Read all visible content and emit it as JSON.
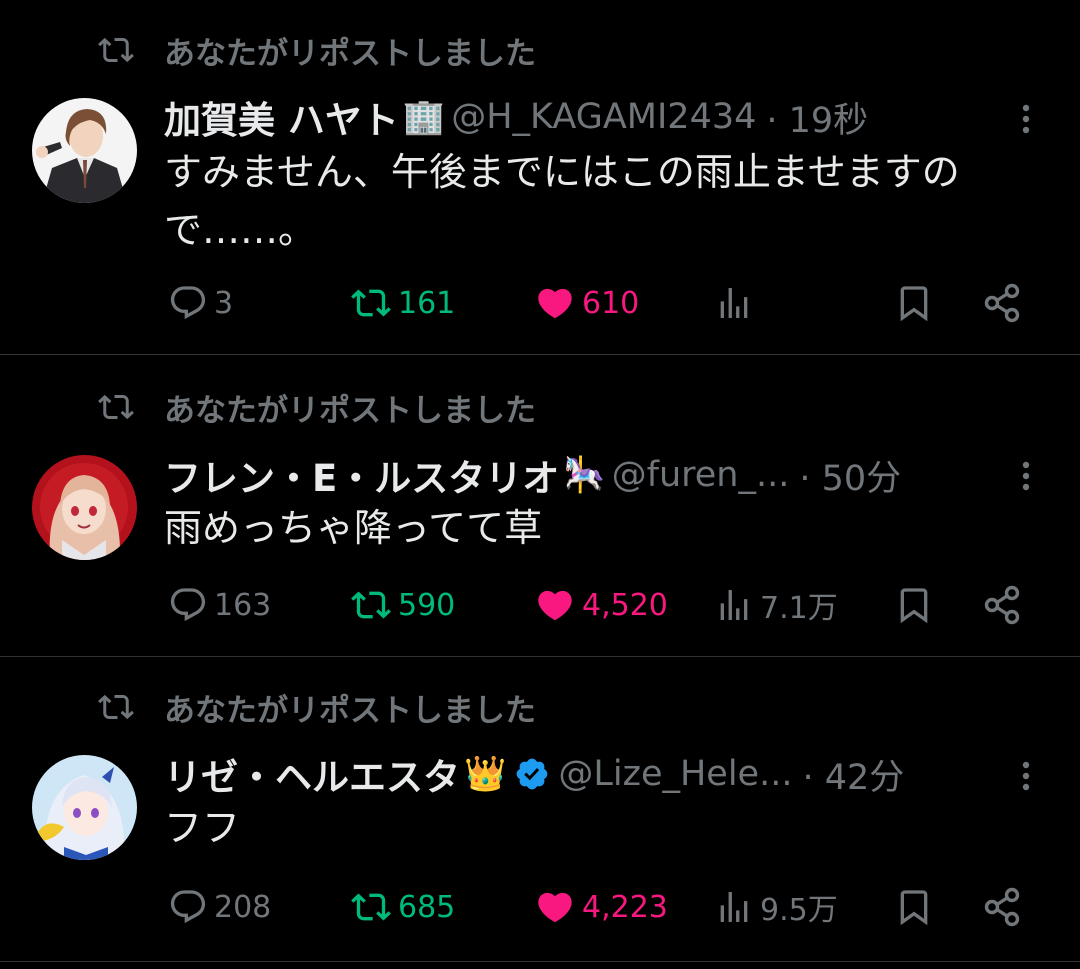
{
  "colors": {
    "background": "#000000",
    "primary_text": "#e7e9ea",
    "secondary_text": "#71767b",
    "retweet_green": "#00ba7c",
    "like_pink": "#f91880",
    "verified_blue": "#1d9bf0",
    "divider": "#2f3336"
  },
  "tweets": [
    {
      "repost_label": "あなたがリポストしました",
      "display_name": "加賀美 ハヤト",
      "name_emoji": "🏢",
      "handle": "@H_KAGAMI2434",
      "time": "· 19秒",
      "text": "すみません、午後までにはこの雨止ませますので……。",
      "replies": "3",
      "reposts": "161",
      "likes": "610",
      "views": "",
      "liked": true,
      "reposted": true,
      "verified": false
    },
    {
      "repost_label": "あなたがリポストしました",
      "display_name": "フレン・E・ルスタリオ",
      "name_emoji": "🎠",
      "handle": "@furen_...",
      "time": "· 50分",
      "text": "雨めっちゃ降ってて草",
      "replies": "163",
      "reposts": "590",
      "likes": "4,520",
      "views": "7.1万",
      "liked": true,
      "reposted": true,
      "verified": false
    },
    {
      "repost_label": "あなたがリポストしました",
      "display_name": "リゼ・ヘルエスタ",
      "name_emoji": "👑",
      "handle": "@Lize_Hele...",
      "time": "· 42分",
      "text": "フフ",
      "replies": "208",
      "reposts": "685",
      "likes": "4,223",
      "views": "9.5万",
      "liked": true,
      "reposted": true,
      "verified": true
    }
  ],
  "icons": {
    "repost": "repost-icon",
    "more": "more-vertical-icon",
    "reply": "reply-icon",
    "retweet": "retweet-icon",
    "like": "heart-icon",
    "views": "views-icon",
    "bookmark": "bookmark-icon",
    "share": "share-icon",
    "verified": "verified-badge-icon"
  }
}
